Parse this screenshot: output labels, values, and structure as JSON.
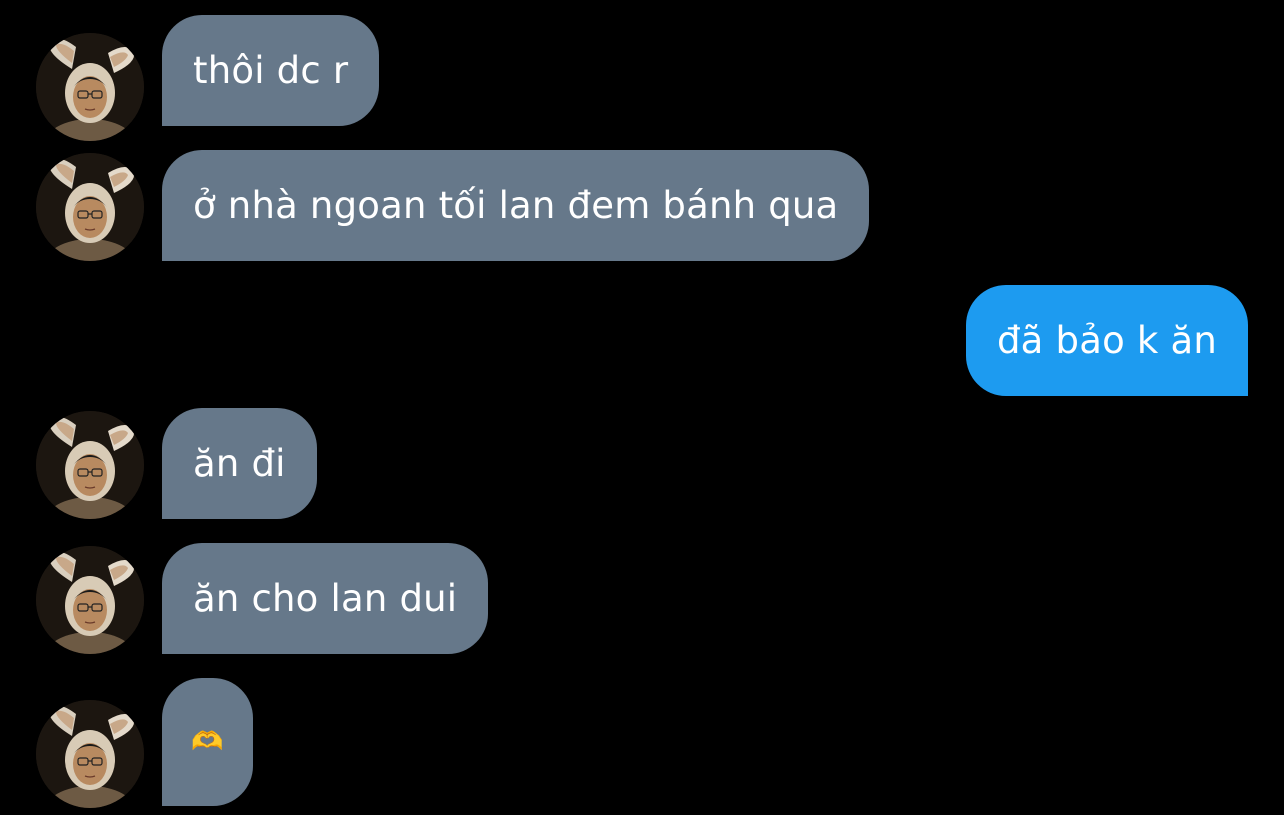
{
  "conversation": {
    "accent_incoming": "#66788a",
    "accent_outgoing": "#1d9bf0",
    "messages": [
      {
        "sender": "other",
        "text": "thôi dc r",
        "avatar_icon": "bunny-ears-person-avatar"
      },
      {
        "sender": "other",
        "text": "ở nhà ngoan tối lan đem bánh qua",
        "avatar_icon": "bunny-ears-person-avatar"
      },
      {
        "sender": "me",
        "text": "đã bảo k ăn"
      },
      {
        "sender": "other",
        "text": "ăn đi",
        "avatar_icon": "bunny-ears-person-avatar"
      },
      {
        "sender": "other",
        "text": "ăn cho lan dui",
        "avatar_icon": "bunny-ears-person-avatar"
      },
      {
        "sender": "other",
        "text": "🫶",
        "avatar_icon": "bunny-ears-person-avatar"
      }
    ]
  }
}
